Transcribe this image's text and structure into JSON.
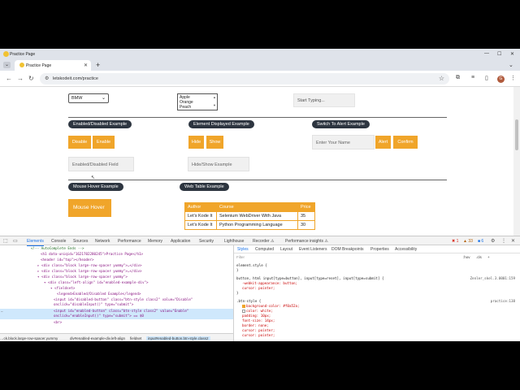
{
  "window": {
    "title": "Practice Page",
    "controls": [
      "—",
      "☐",
      "✕"
    ]
  },
  "tab": {
    "label": "Practice Page",
    "close": "✕",
    "new_tab": "+",
    "down": "⌄"
  },
  "toolbar": {
    "url": "letskodeit.com/practice"
  },
  "page": {
    "select_value": "BMW",
    "multi_options": [
      "Apple",
      "Orange",
      "Peach"
    ],
    "text_placeholder": "Start Typing...",
    "enabled_disabled_title": "Enabled/Disabled Example",
    "element_displayed_title": "Element Displayed Example",
    "switch_alert_title": "Switch To Alert Example",
    "disable_label": "Disable",
    "enable_label": "Enable",
    "hide_label": "Hide",
    "show_label": "Show",
    "name_placeholder": "Enter Your Name",
    "alert_label": "Alert",
    "confirm_label": "Confirm",
    "enabled_disabled_placeholder": "Enabled/Disabled Field",
    "hide_show_placeholder": "Hide/Show Example",
    "mouse_hover_title": "Mouse Hover Example",
    "web_table_title": "Web Table Example",
    "mouse_hover_label": "Mouse Hover",
    "table": {
      "headers": [
        "Author",
        "Course",
        "Price"
      ],
      "rows": [
        [
          "Let's Kode It",
          "Selenium WebDriver With Java",
          "35"
        ],
        [
          "Let's Kode It",
          "Python Programming Language",
          "30"
        ]
      ]
    }
  },
  "devtools": {
    "tabs": [
      "Elements",
      "Console",
      "Sources",
      "Network",
      "Performance",
      "Memory",
      "Application",
      "Security",
      "Lighthouse",
      "Recorder ⚠",
      "Performance insights ⚠"
    ],
    "active_tab": "Elements",
    "errors": "1",
    "warnings": "33",
    "info": "6",
    "element_lines": [
      "<!-- AutoComplete Ends -->",
      "<h1 data-uniqid=\"1621702280245\">Practice Page</h1>",
      "<header id=\"top\"></header>",
      "<div class=\"block large-row-spacer yummy\">…</div>",
      "<div class=\"block large-row-spacer yummy\">…</div>",
      "<div class=\"block large-row-spacer yummy\">",
      "<div class=\"left-align\" id=\"enabled-example-div\">",
      "<fieldset>",
      "<legend>Enabled/Disabled Example</legend>",
      "<input id=\"disabled-button\" class=\"btn-style class2\" value=\"Disable\" onclick=\"disableInput()\" type=\"submit\">",
      "<input id=\"enabled-button\" class=\"btn-style class2\" value=\"Enable\" onclick=\"enableInput()\" type=\"submit\"> == $0",
      "<br>"
    ],
    "breadcrumbs": [
      "…ck.block.large-row-spacer.yummy",
      "div#enabled-example-div.left-align",
      "fieldset",
      "input#enabled-button.btn-style.class2"
    ],
    "styles_tabs": [
      "Styles",
      "Computed",
      "Layout",
      "Event Listeners",
      "DOM Breakpoints",
      "Properties",
      "Accessibility"
    ],
    "filter_placeholder": "Filter",
    "filter_right": [
      ":hov",
      ".cls",
      "+"
    ],
    "css": {
      "element_style": "element.style {",
      "rule1_selector": "button, html input[type=button], input[type=reset], input[type=submit] {",
      "rule1_source": "Zenler_skel.3.0001:159",
      "rule1_props": [
        "-webkit-appearance: button;",
        "cursor: pointer;"
      ],
      "rule2_selector": ".btn-style {",
      "rule2_source": "practice:138",
      "rule2_props": [
        "background-color: #f0a52a;",
        "color: white;",
        "padding: 10px;",
        "font-size: 14px;",
        "border: none;",
        "cursor: pointer;",
        "cursor: pointer;"
      ],
      "close_brace": "}"
    }
  }
}
